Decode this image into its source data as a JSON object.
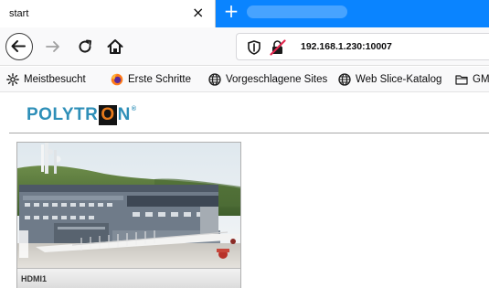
{
  "browser": {
    "tab_title": "start",
    "tab_close": "×",
    "new_tab": "+",
    "url": "192.168.1.230:10007"
  },
  "bookmarks": [
    {
      "label": "Meistbesucht",
      "icon": "gear-icon"
    },
    {
      "label": "Erste Schritte",
      "icon": "firefox-icon"
    },
    {
      "label": "Vorgeschlagene Sites",
      "icon": "globe-icon"
    },
    {
      "label": "Web Slice-Katalog",
      "icon": "globe-icon"
    },
    {
      "label": "GM",
      "icon": "folder-icon"
    }
  ],
  "page": {
    "logo": {
      "before": "POLYTR",
      "boxed": "O",
      "after": "N",
      "mark": "®"
    },
    "camera_card": {
      "caption": "HDMI1"
    }
  },
  "colors": {
    "tabbar": "#0a84ff",
    "logo_blue": "#2e8fb8",
    "logo_orange": "#e87a1b"
  }
}
